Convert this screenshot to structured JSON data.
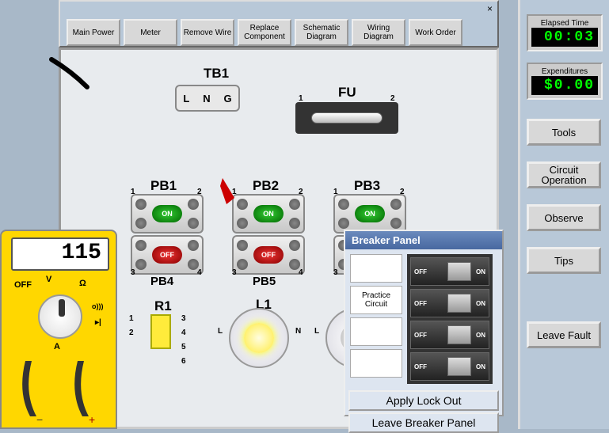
{
  "toolbar": {
    "close": "×",
    "buttons": {
      "main_power": "Main Power",
      "meter": "Meter",
      "remove_wire": "Remove Wire",
      "replace_component": "Replace Component",
      "schematic": "Schematic Diagram",
      "wiring": "Wiring Diagram",
      "work_order": "Work Order"
    }
  },
  "sidebar": {
    "elapsed_label": "Elapsed Time",
    "elapsed_value": "00:03",
    "expend_label": "Expenditures",
    "expend_value": "$0.00",
    "tools": "Tools",
    "circuit_op": "Circuit Operation",
    "observe": "Observe",
    "tips": "Tips",
    "leave_fault": "Leave Fault"
  },
  "meter": {
    "reading": "115",
    "off": "OFF",
    "v": "V",
    "ohm": "Ω",
    "sound": "o)))",
    "diode": "▸|",
    "a": "A"
  },
  "components": {
    "tb1": "TB1",
    "tb1_l": "L",
    "tb1_n": "N",
    "tb1_g": "G",
    "fu": "FU",
    "pb1": "PB1",
    "pb2": "PB2",
    "pb3": "PB3",
    "pb4": "PB4",
    "pb5": "PB5",
    "on": "ON",
    "off": "OFF",
    "r1": "R1",
    "l1": "L1",
    "l_term": "L",
    "n_term": "N",
    "t1": "1",
    "t2": "2",
    "t3": "3",
    "t4": "4",
    "t5": "5",
    "t6": "6"
  },
  "breaker": {
    "title": "Breaker Panel",
    "practice": "Practice Circuit",
    "off": "OFF",
    "on": "ON",
    "apply": "Apply Lock Out",
    "leave": "Leave Breaker Panel"
  }
}
